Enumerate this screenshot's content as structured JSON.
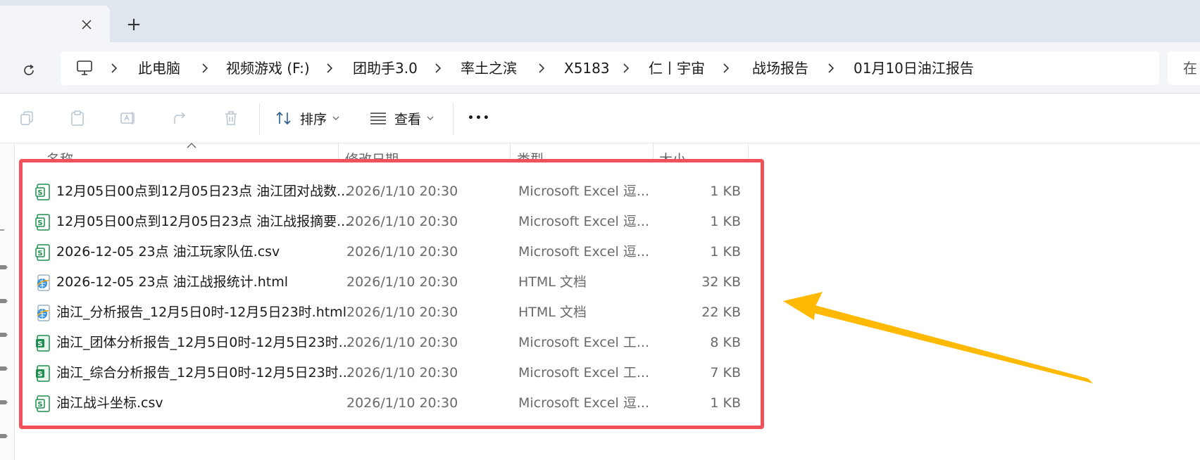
{
  "tabs": {
    "close_icon": "close-icon",
    "new_tab_symbol": "+"
  },
  "address_bar": {
    "refresh_icon": "refresh-icon",
    "root_icon": "computer-icon",
    "breadcrumbs": [
      "此电脑",
      "视频游戏 (F:)",
      "团助手3.0",
      "率土之滨",
      "X5183",
      "仁丨宇宙",
      "战场报告",
      "01月10日油江报告"
    ],
    "search_partial": "在"
  },
  "toolbar": {
    "icons": [
      "copy-icon",
      "paste-icon",
      "rename-icon",
      "share-icon",
      "delete-icon"
    ],
    "sort_label": "排序",
    "view_label": "查看",
    "more_label": "•••"
  },
  "columns": {
    "name": "名称",
    "modified": "修改日期",
    "type": "类型",
    "size": "大小"
  },
  "files": [
    {
      "name": "12月05日00点到12月05日23点 油江团对战数...",
      "date": "2026/1/10 20:30",
      "type": "Microsoft Excel 逗...",
      "size": "1 KB",
      "icon": "csv-file-icon"
    },
    {
      "name": "12月05日00点到12月05日23点 油江战报摘要....",
      "date": "2026/1/10 20:30",
      "type": "Microsoft Excel 逗...",
      "size": "1 KB",
      "icon": "csv-file-icon"
    },
    {
      "name": "2026-12-05 23点 油江玩家队伍.csv",
      "date": "2026/1/10 20:30",
      "type": "Microsoft Excel 逗...",
      "size": "1 KB",
      "icon": "csv-file-icon"
    },
    {
      "name": "2026-12-05 23点 油江战报统计.html",
      "date": "2026/1/10 20:30",
      "type": "HTML 文档",
      "size": "32 KB",
      "icon": "html-file-icon"
    },
    {
      "name": "油江_分析报告_12月5日0时-12月5日23时.html",
      "date": "2026/1/10 20:30",
      "type": "HTML 文档",
      "size": "22 KB",
      "icon": "html-file-icon"
    },
    {
      "name": "油江_团体分析报告_12月5日0时-12月5日23时...",
      "date": "2026/1/10 20:30",
      "type": "Microsoft Excel 工...",
      "size": "8 KB",
      "icon": "xlsx-file-icon"
    },
    {
      "name": "油江_综合分析报告_12月5日0时-12月5日23时...",
      "date": "2026/1/10 20:30",
      "type": "Microsoft Excel 工...",
      "size": "7 KB",
      "icon": "xlsx-file-icon"
    },
    {
      "name": "油江战斗坐标.csv",
      "date": "2026/1/10 20:30",
      "type": "Microsoft Excel 逗...",
      "size": "1 KB",
      "icon": "csv-file-icon"
    }
  ],
  "annotation": {
    "box_color": "#f1525a",
    "arrow_color": "#ffb900"
  }
}
